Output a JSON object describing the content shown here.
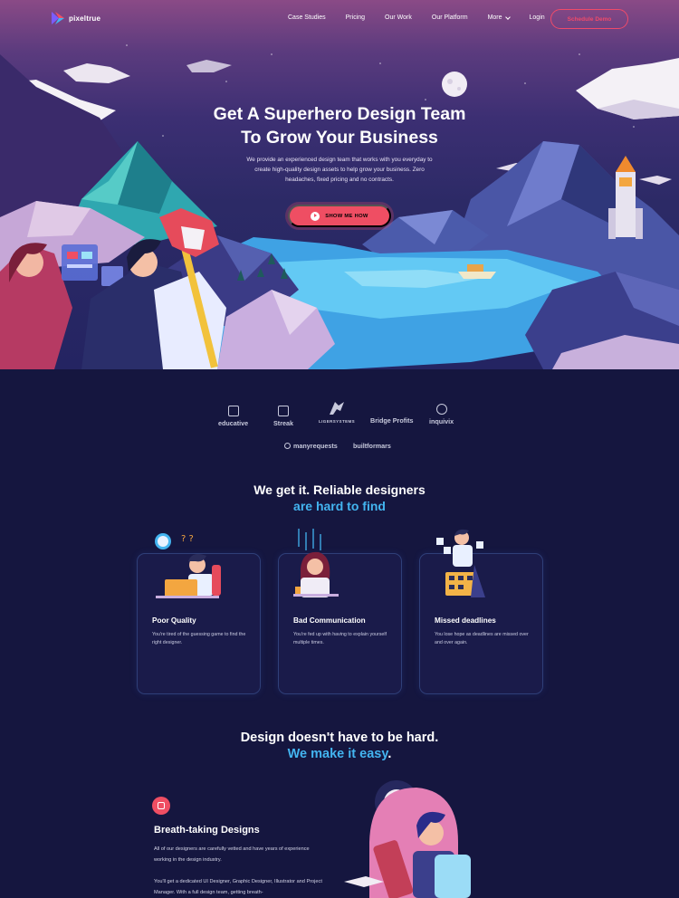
{
  "brand": {
    "name": "pixeltrue"
  },
  "nav": {
    "links": [
      "Case Studies",
      "Pricing",
      "Our Work",
      "Our Platform"
    ],
    "more_label": "More",
    "login_label": "Login",
    "cta_label": "Schedule Demo"
  },
  "hero": {
    "title_line1": "Get A Superhero Design Team",
    "title_line2": "To Grow Your Business",
    "subtitle": "We provide an experienced design team that works with you everyday to create high-quality design assets to help grow your business. Zero headaches, fixed pricing and no contracts.",
    "cta_label": "SHOW ME HOW"
  },
  "clients": [
    "educative",
    "Streak",
    "LIGERSYSTEMS",
    "Bridge Profits",
    "inquivix",
    "manyrequests",
    "builtformars"
  ],
  "problems": {
    "heading_line1": "We get it. Reliable designers",
    "heading_line2": "are hard to find",
    "cards": [
      {
        "title": "Poor Quality",
        "desc": "You're tired of the guessing game to find the right designer."
      },
      {
        "title": "Bad Communication",
        "desc": "You're fed up with having to explain yourself multiple times."
      },
      {
        "title": "Missed deadlines",
        "desc": "You lose hope as deadlines are missed over and over again."
      }
    ]
  },
  "solution": {
    "heading_line1": "Design doesn't have to be hard.",
    "heading_accent": "We make it easy",
    "heading_period": ".",
    "feature_title": "Breath-taking Designs",
    "feature_p1": "All of our designers are carefully vetted and have years of experience working in the design industry.",
    "feature_p2": "You'll get a dedicated UI Designer, Graphic Designer, Illustrator and Project Manager. With a full design team, getting breath-"
  },
  "colors": {
    "accent": "#43b4f0",
    "cta": "#ef4e63",
    "background": "#15163f"
  }
}
